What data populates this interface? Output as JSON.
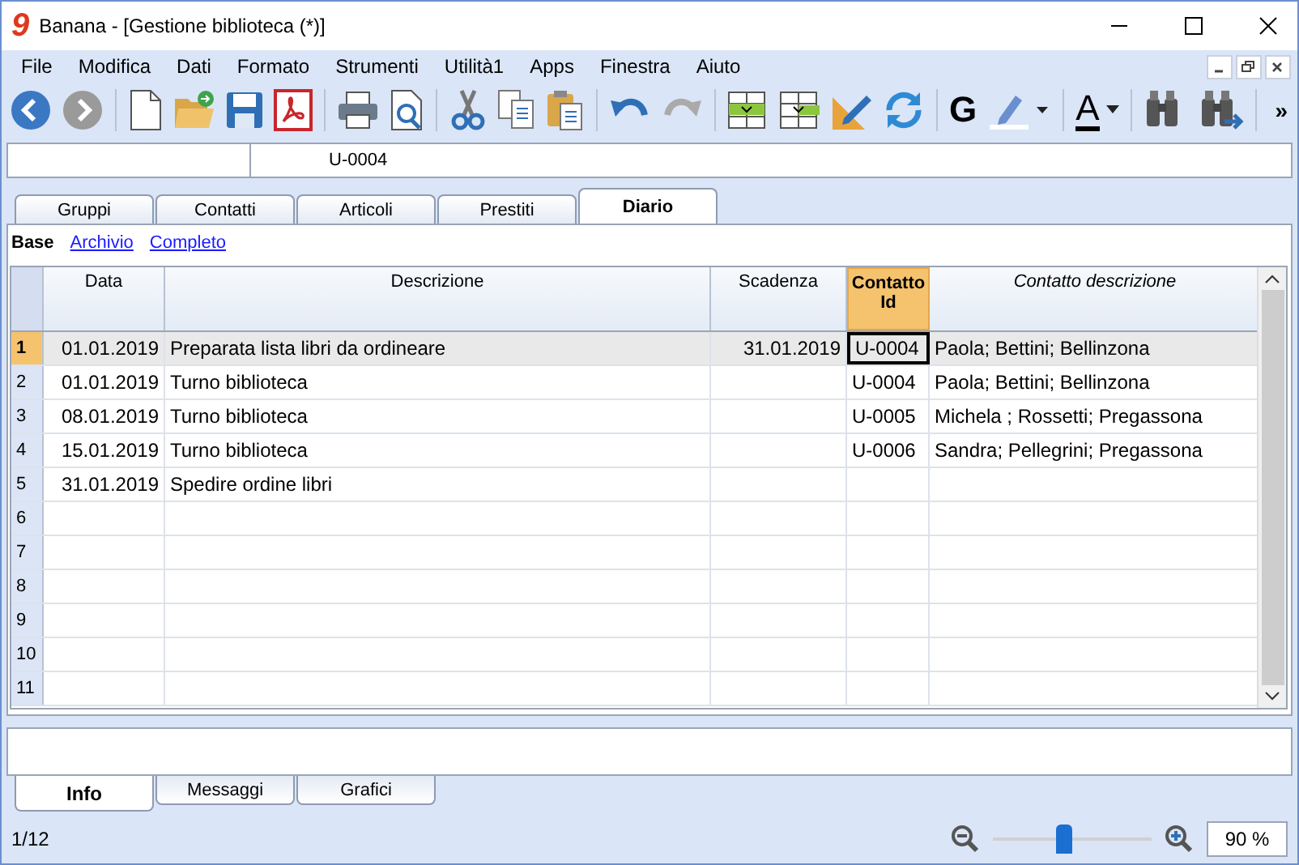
{
  "window": {
    "logo": "9",
    "title": "Banana - [Gestione biblioteca (*)]"
  },
  "menu": [
    "File",
    "Modifica",
    "Dati",
    "Formato",
    "Strumenti",
    "Utilità1",
    "Apps",
    "Finestra",
    "Aiuto"
  ],
  "toolbar": [
    {
      "kind": "back",
      "disabled": false
    },
    {
      "kind": "forward",
      "disabled": true
    },
    {
      "kind": "new",
      "disabled": false
    },
    {
      "kind": "open",
      "disabled": false
    },
    {
      "kind": "save",
      "disabled": false
    },
    {
      "kind": "pdf",
      "disabled": false
    },
    {
      "kind": "print",
      "disabled": false
    },
    {
      "kind": "preview",
      "disabled": false
    },
    {
      "kind": "cut",
      "disabled": false
    },
    {
      "kind": "copy",
      "disabled": false
    },
    {
      "kind": "paste",
      "disabled": false
    },
    {
      "kind": "undo",
      "disabled": false
    },
    {
      "kind": "redo",
      "disabled": true
    },
    {
      "kind": "insertrow",
      "disabled": false
    },
    {
      "kind": "deleterow",
      "disabled": false
    },
    {
      "kind": "edit",
      "disabled": false
    },
    {
      "kind": "refresh",
      "disabled": false
    },
    {
      "kind": "bold",
      "label": "G",
      "disabled": false
    },
    {
      "kind": "highlight",
      "disabled": false
    },
    {
      "kind": "fontcolor",
      "label": "A",
      "disabled": false
    },
    {
      "kind": "find",
      "disabled": false
    },
    {
      "kind": "findnext",
      "disabled": false
    },
    {
      "kind": "more",
      "label": "»",
      "disabled": false
    }
  ],
  "cell_bar": {
    "value": "U-0004"
  },
  "tabs": [
    {
      "label": "Gruppi",
      "selected": false
    },
    {
      "label": "Contatti",
      "selected": false
    },
    {
      "label": "Articoli",
      "selected": false
    },
    {
      "label": "Prestiti",
      "selected": false
    },
    {
      "label": "Diario",
      "selected": true
    }
  ],
  "views": [
    {
      "label": "Base",
      "selected": true
    },
    {
      "label": "Archivio",
      "selected": false
    },
    {
      "label": "Completo",
      "selected": false
    }
  ],
  "table": {
    "columns": [
      {
        "title": "Data",
        "selected": false,
        "italic": false
      },
      {
        "title": "Descrizione",
        "selected": false,
        "italic": false
      },
      {
        "title": "Scadenza",
        "selected": false,
        "italic": false
      },
      {
        "title": "Contatto Id",
        "selected": true,
        "italic": false
      },
      {
        "title": "Contatto descrizione",
        "selected": false,
        "italic": true
      }
    ],
    "rows": [
      {
        "number": "1",
        "selected": true,
        "cells": [
          "01.01.2019",
          "Preparata lista libri da ordineare",
          "31.01.2019",
          "U-0004",
          "Paola; Bettini; Bellinzona"
        ]
      },
      {
        "number": "2",
        "selected": false,
        "cells": [
          "01.01.2019",
          "Turno biblioteca",
          null,
          "U-0004",
          "Paola; Bettini; Bellinzona"
        ]
      },
      {
        "number": "3",
        "selected": false,
        "cells": [
          "08.01.2019",
          "Turno biblioteca",
          null,
          "U-0005",
          "Michela ; Rossetti; Pregassona"
        ]
      },
      {
        "number": "4",
        "selected": false,
        "cells": [
          "15.01.2019",
          "Turno biblioteca",
          null,
          "U-0006",
          "Sandra; Pellegrini; Pregassona"
        ]
      },
      {
        "number": "5",
        "selected": false,
        "cells": [
          "31.01.2019",
          "Spedire ordine libri",
          null,
          null,
          null
        ]
      },
      {
        "number": "6",
        "selected": false,
        "cells": [
          null,
          null,
          null,
          null,
          null
        ]
      },
      {
        "number": "7",
        "selected": false,
        "cells": [
          null,
          null,
          null,
          null,
          null
        ]
      },
      {
        "number": "8",
        "selected": false,
        "cells": [
          null,
          null,
          null,
          null,
          null
        ]
      },
      {
        "number": "9",
        "selected": false,
        "cells": [
          null,
          null,
          null,
          null,
          null
        ]
      },
      {
        "number": "10",
        "selected": false,
        "cells": [
          null,
          null,
          null,
          null,
          null
        ]
      },
      {
        "number": "11",
        "selected": false,
        "cells": [
          null,
          null,
          null,
          null,
          null
        ]
      }
    ]
  },
  "bottom_tabs": [
    {
      "label": "Info",
      "selected": true
    },
    {
      "label": "Messaggi",
      "selected": false
    },
    {
      "label": "Grafici",
      "selected": false
    }
  ],
  "status_bar": {
    "position": "1/12",
    "zoom": {
      "level": 0.45,
      "value": "90 %"
    }
  }
}
